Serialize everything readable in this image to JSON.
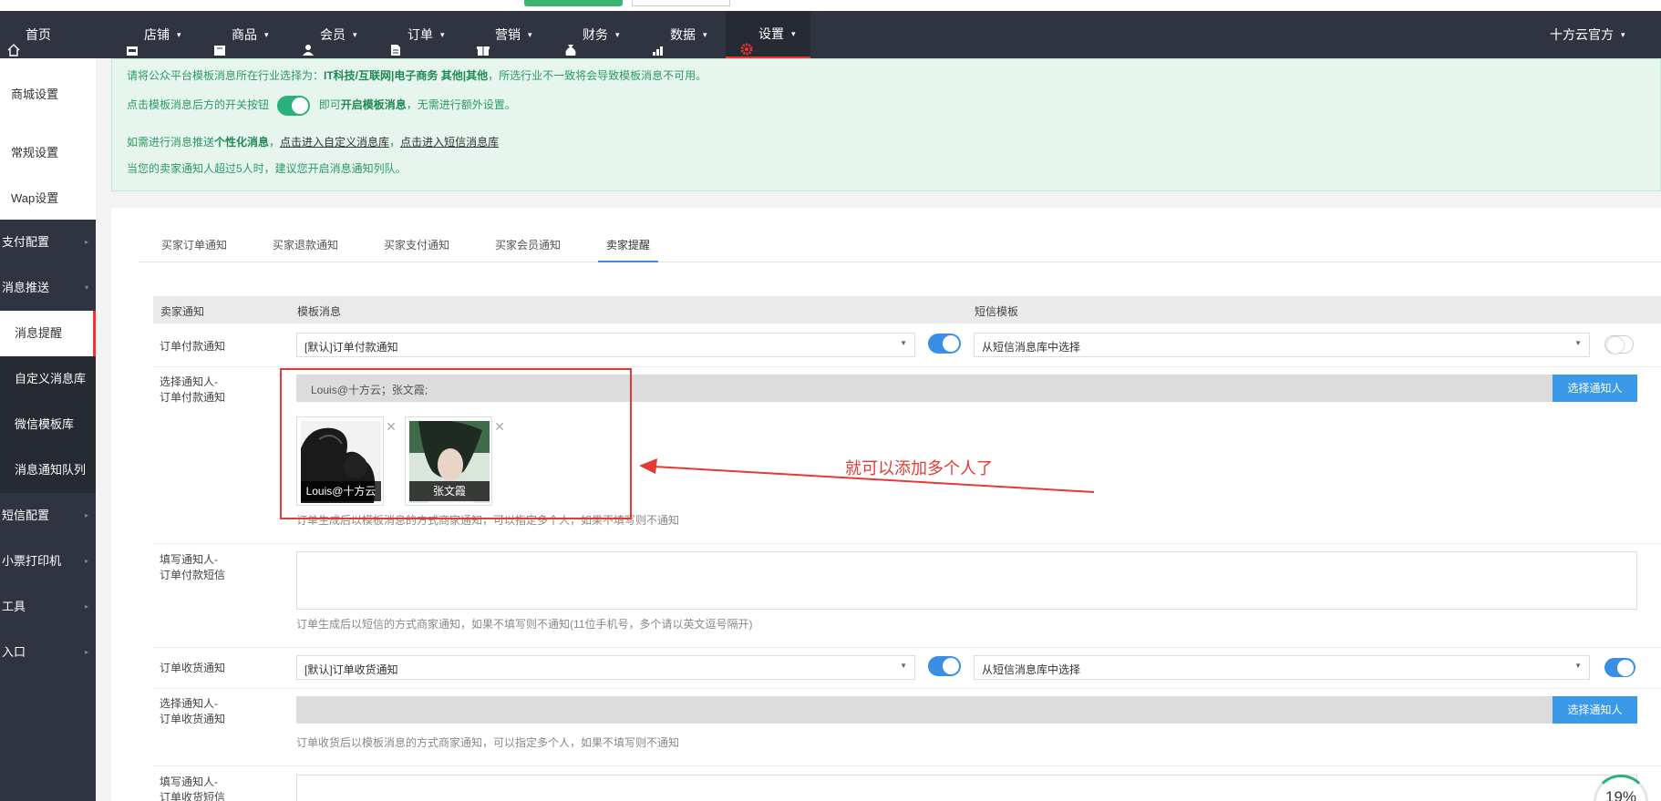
{
  "nav": {
    "home": "首页",
    "items": [
      {
        "label": "店铺",
        "icon": "shop-icon"
      },
      {
        "label": "商品",
        "icon": "goods-icon"
      },
      {
        "label": "会员",
        "icon": "user-icon"
      },
      {
        "label": "订单",
        "icon": "order-icon"
      },
      {
        "label": "营销",
        "icon": "gift-icon"
      },
      {
        "label": "财务",
        "icon": "money-bag-icon"
      },
      {
        "label": "数据",
        "icon": "chart-icon"
      },
      {
        "label": "设置",
        "icon": "gear-icon"
      }
    ],
    "account": "十方云官方"
  },
  "sidebar": {
    "top_items": [
      "商城设置",
      "常规设置",
      "Wap设置"
    ],
    "groups": [
      "支付配置",
      "消息推送"
    ],
    "sub_items": [
      "消息提醒",
      "自定义消息库",
      "微信模板库",
      "消息通知队列"
    ],
    "bottom_groups": [
      "短信配置",
      "小票打印机",
      "工具",
      "入口"
    ]
  },
  "info": {
    "line1_prefix": "请将公众平台模板消息所在行业选择为：",
    "line1_bold": "IT科技/互联网|电子商务 其他|其他",
    "line1_suffix": "，所选行业不一致将会导致模板消息不可用。",
    "line2_prefix": "点击模板消息后方的开关按钮",
    "line2_mid": "即可",
    "line2_bold": "开启模板消息",
    "line2_suffix": "，无需进行额外设置。",
    "line3_prefix": "如需进行消息推送",
    "line3_bold": "个性化消息",
    "line3_link1": "点击进入自定义消息库",
    "line3_link2": "点击进入短信消息库",
    "line4": "当您的卖家通知人超过5人时，建议您开启消息通知列队。"
  },
  "tabs": [
    "买家订单通知",
    "买家退款通知",
    "买家支付通知",
    "买家会员通知",
    "卖家提醒"
  ],
  "table": {
    "headers": [
      "卖家通知",
      "模板消息",
      "短信模板"
    ],
    "row1": {
      "label": "订单付款通知",
      "template": "[默认]订单付款通知",
      "sms": "从短信消息库中选择"
    },
    "row2": {
      "label1": "选择通知人-",
      "label2": "订单付款通知",
      "people_text": "Louis@十方云；张文霞;",
      "button": "选择通知人",
      "cards": [
        "Louis@十方云",
        "张文霞"
      ],
      "hint": "订单生成后以模板消息的方式商家通知，可以指定多个人，如果不填写则不通知"
    },
    "row3": {
      "label1": "填写通知人-",
      "label2": "订单付款短信",
      "hint": "订单生成后以短信的方式商家通知，如果不填写则不通知(11位手机号，多个请以英文逗号隔开)"
    },
    "row4": {
      "label": "订单收货通知",
      "template": "[默认]订单收货通知",
      "sms": "从短信消息库中选择"
    },
    "row5": {
      "label1": "选择通知人-",
      "label2": "订单收货通知",
      "button": "选择通知人",
      "hint": "订单收货后以模板消息的方式商家通知，可以指定多个人，如果不填写则不通知"
    },
    "row6": {
      "label1": "填写通知人-",
      "label2": "订单收货短信"
    }
  },
  "annotation": "就可以添加多个人了",
  "progress": "19%",
  "colors": {
    "accent": "#3a8ee6",
    "annotation": "#e53935",
    "success": "#27b27a"
  }
}
